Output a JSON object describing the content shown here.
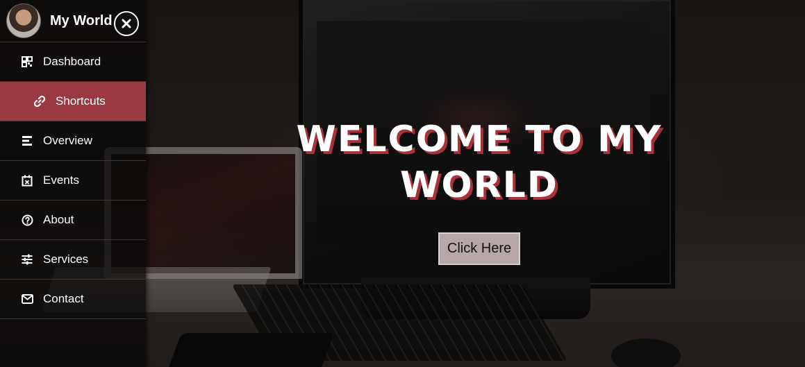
{
  "sidebar": {
    "brand": "My World",
    "items": [
      {
        "label": "Dashboard",
        "icon": "grid-icon"
      },
      {
        "label": "Shortcuts",
        "icon": "link-icon",
        "active": true
      },
      {
        "label": "Overview",
        "icon": "bars-icon"
      },
      {
        "label": "Events",
        "icon": "calendar-icon"
      },
      {
        "label": "About",
        "icon": "question-circle-icon"
      },
      {
        "label": "Services",
        "icon": "sliders-icon"
      },
      {
        "label": "Contact",
        "icon": "envelope-icon"
      }
    ]
  },
  "hero": {
    "title_line1": "WELCOME TO MY",
    "title_line2": "WORLD",
    "button_label": "Click Here"
  },
  "colors": {
    "accent": "#9a3a40",
    "title_shadow": "#a8323a",
    "button_bg": "#b6a8a9"
  }
}
